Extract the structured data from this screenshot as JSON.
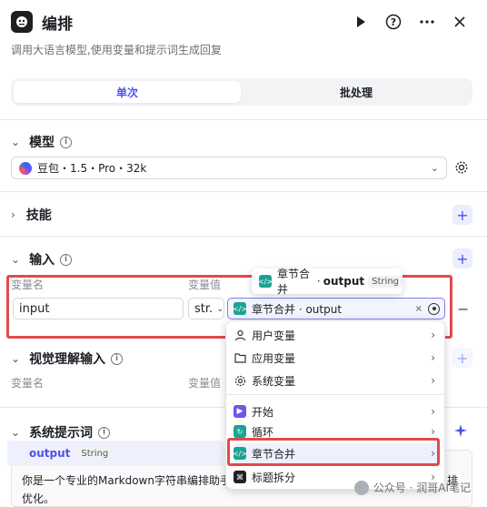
{
  "header": {
    "title": "编排",
    "subtitle": "调用大语言模型,使用变量和提示词生成回复",
    "icons": [
      "play-icon",
      "help-icon",
      "more-icon",
      "close-icon"
    ]
  },
  "tabs": {
    "single": "单次",
    "batch": "批处理"
  },
  "model": {
    "label": "模型",
    "value": "豆包・1.5・Pro・32k"
  },
  "skills": {
    "label": "技能"
  },
  "input": {
    "label": "输入",
    "col_name": "变量名",
    "col_value": "变量值",
    "row_name": "input",
    "row_type": "str.",
    "row_ref": "章节合并 · output",
    "remove": "−"
  },
  "tooltip": {
    "node": "章节合并",
    "sep": "·",
    "var": "output",
    "type": "String"
  },
  "vision": {
    "label": "视觉理解输入",
    "col_name": "变量名",
    "col_value": "变量值"
  },
  "menu": {
    "items": [
      {
        "label": "用户变量"
      },
      {
        "label": "应用变量"
      },
      {
        "label": "系统变量"
      },
      {
        "label": "开始"
      },
      {
        "label": "循环"
      },
      {
        "label": "章节合并"
      },
      {
        "label": "标题拆分"
      }
    ]
  },
  "system_prompt": {
    "label": "系统提示词",
    "suggest_var": "output",
    "suggest_type": "String",
    "text_line1": "你是一个专业的Markdown字符串编排助手",
    "text_line1_end": "排",
    "text_line2": "优化。"
  },
  "watermark": {
    "text": "公众号 · 润哥AI笔记"
  },
  "colors": {
    "accent": "#4d53e8",
    "highlight_red": "#e24a4a",
    "teal": "#19a392"
  }
}
